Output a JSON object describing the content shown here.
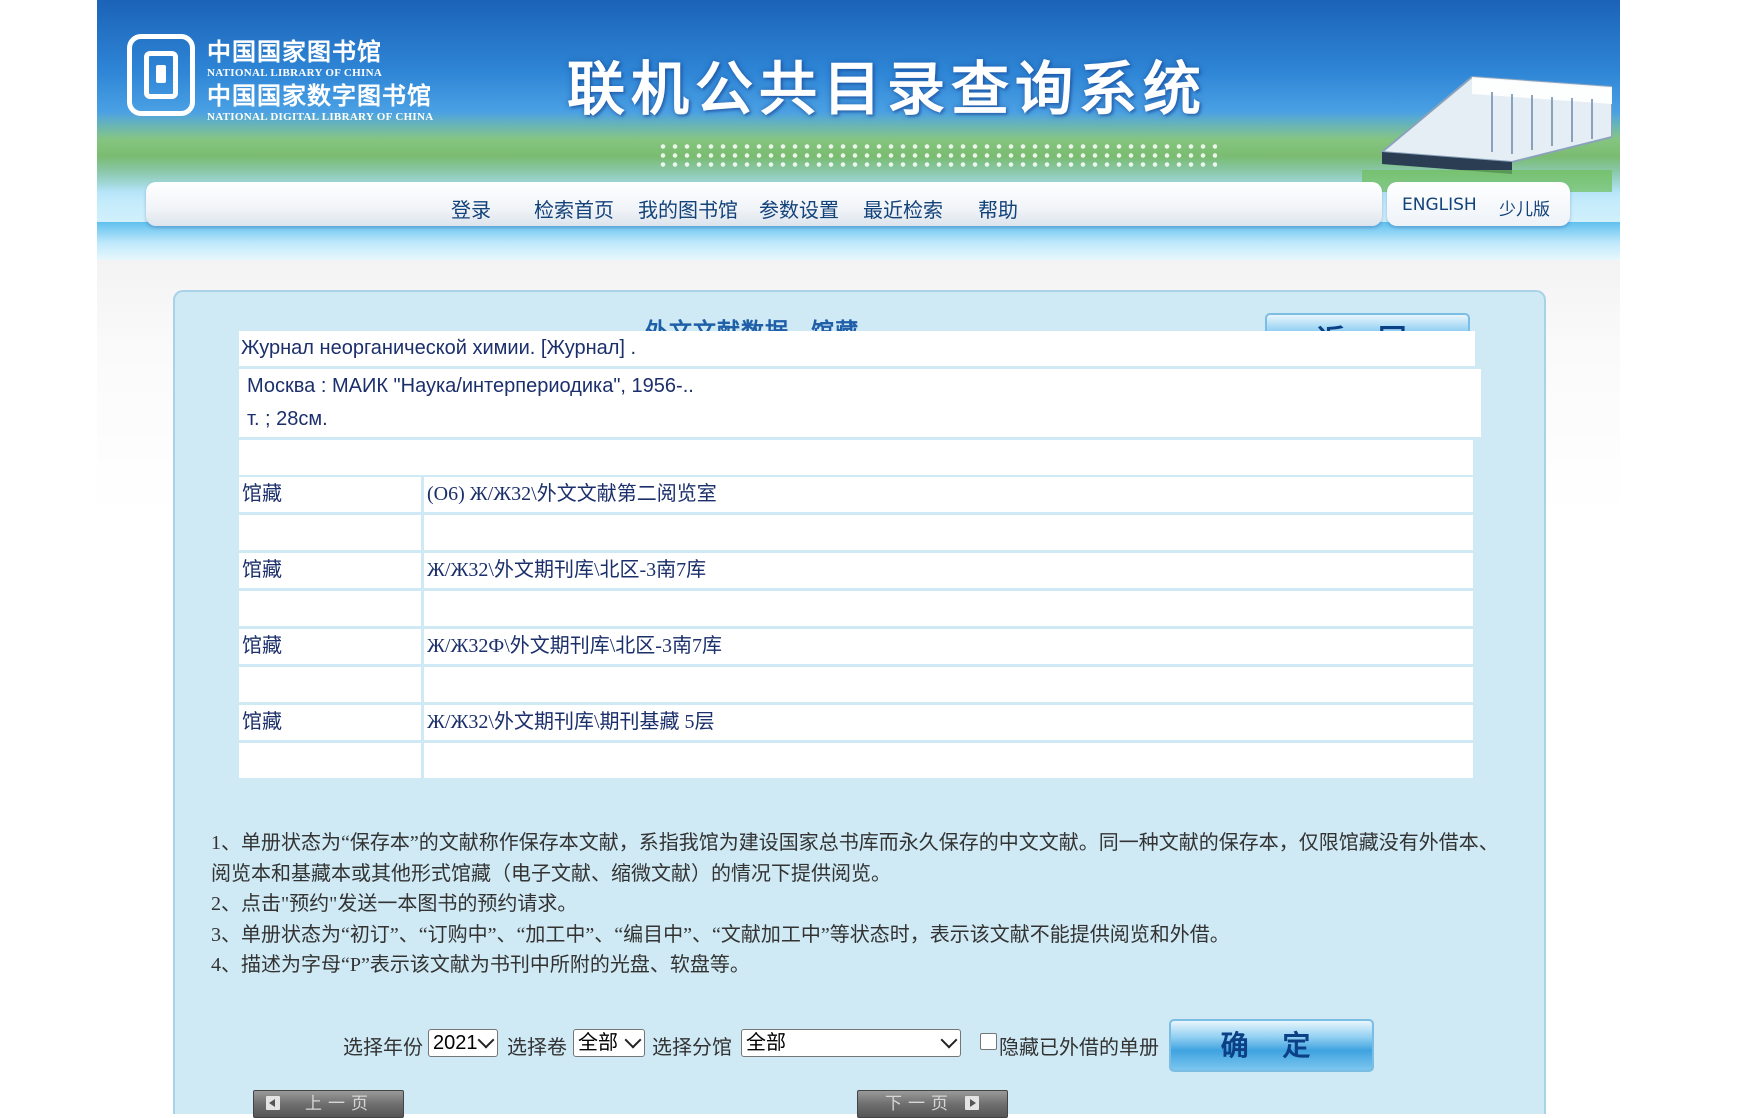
{
  "header": {
    "logo_cn_1": "中国国家图书馆",
    "logo_en_1": "NATIONAL LIBRARY OF CHINA",
    "logo_cn_2": "中国国家数字图书馆",
    "logo_en_2": "NATIONAL DIGITAL LIBRARY OF CHINA",
    "site_title": "联机公共目录查询系统",
    "nav": [
      "登录",
      "检索首页",
      "我的图书馆",
      "参数设置",
      "最近检索",
      "帮助"
    ],
    "lang": [
      "ENGLISH",
      "少儿版"
    ]
  },
  "panel": {
    "title": "外文文献数据 - 馆藏",
    "back_label": "返 回"
  },
  "record": {
    "title_line": "Журнал неорганической химии. [Журнал] .",
    "publication_line": "Москва : МАИК \"Наука/интерпериодика\", 1956-..",
    "physical_line": "т. ; 28см.",
    "empty_line": ""
  },
  "holdings": [
    {
      "label": "馆藏",
      "value": "(O6) Ж/Ж32\\外文文献第二阅览室"
    },
    {
      "label": "",
      "value": ""
    },
    {
      "label": "馆藏",
      "value": "Ж/Ж32\\外文期刊库\\北区-3南7库"
    },
    {
      "label": "",
      "value": ""
    },
    {
      "label": "馆藏",
      "value": "Ж/Ж32Ф\\外文期刊库\\北区-3南7库"
    },
    {
      "label": "",
      "value": ""
    },
    {
      "label": "馆藏",
      "value": "Ж/Ж32\\外文期刊库\\期刊基藏 5层"
    },
    {
      "label": "",
      "value": ""
    }
  ],
  "notes": [
    "1、单册状态为“保存本”的文献称作保存本文献，系指我馆为建设国家总书库而永久保存的中文文献。同一种文献的保存本，仅限馆藏没有外借本、阅览本和基藏本或其他形式馆藏（电子文献、缩微文献）的情况下提供阅览。",
    "2、点击\"预约\"发送一本图书的预约请求。",
    "3、单册状态为“初订”、“订购中”、“加工中”、“编目中”、“文献加工中”等状态时，表示该文献不能提供阅览和外借。",
    "4、描述为字母“P”表示该文献为书刊中所附的光盘、软盘等。"
  ],
  "filters": {
    "year_label": "选择年份",
    "year_value": "2021",
    "volume_label": "选择卷",
    "volume_value": "全部",
    "branch_label": "选择分馆",
    "branch_value": "全部",
    "hide_label": "隐藏已外借的单册",
    "hide_checked": false,
    "confirm_label": "确 定"
  },
  "pager": {
    "prev_label": "上一页",
    "next_label": "下一页"
  },
  "colors": {
    "panel_bg": "#cfeaf5",
    "title_blue": "#1f5fa8",
    "nav_text": "#12427a",
    "button_blue": "#3fa3e0"
  }
}
